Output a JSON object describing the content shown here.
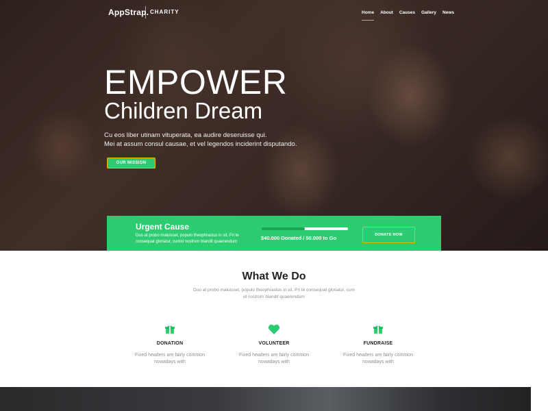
{
  "header": {
    "logo": "AppStrap.",
    "logo_sub": "CHARITY",
    "nav": [
      {
        "label": "Home"
      },
      {
        "label": "About"
      },
      {
        "label": "Causes"
      },
      {
        "label": "Gallery"
      },
      {
        "label": "News"
      }
    ]
  },
  "hero": {
    "title": "EMPOWER",
    "subtitle": "Children Dream",
    "desc_line1": "Cu eos liber utinam vituperata, ea audire deseruisse qui.",
    "desc_line2": "Mei at assum consul causae, et vel legendos inciderint disputando.",
    "mission_button": "OUR MISSION"
  },
  "urgent": {
    "title": "Urgent Cause",
    "desc": "Duo at probo maluisset, populo theophrastus in sit. Pri te consequat gloriatur, cumid nostrum blandit quaerendum",
    "progress": 0.5,
    "donated_text": "$40.000 Donated / 50.000 to Go",
    "donate_button": "DONATE NOW"
  },
  "what_we_do": {
    "title": "What We Do",
    "desc": "Duo at probo maluisset, populo theophrastus in sit. Pri te consequat gloriatur, cum id nostrum blandit quaerendum",
    "services": [
      {
        "icon": "donation-icon",
        "label": "DONATION",
        "text": "Fixed headers are fairly common nowadays with"
      },
      {
        "icon": "heart-icon",
        "label": "VOLUNTEER",
        "text": "Fixed headers are fairly common nowadays with"
      },
      {
        "icon": "fundraise-icon",
        "label": "FUNDRAISE",
        "text": "Fixed headers are fairly common nowadays with"
      }
    ]
  },
  "colors": {
    "accent": "#2ecc71",
    "button_border": "#f2b600"
  }
}
